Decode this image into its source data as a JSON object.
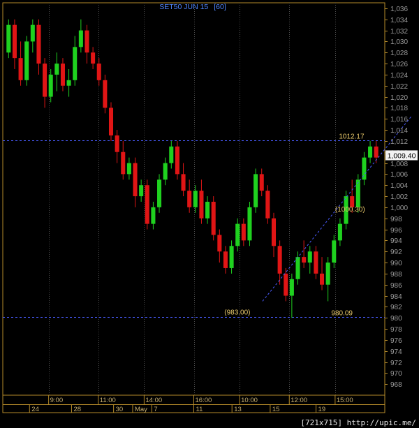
{
  "chart_data": {
    "type": "candlestick",
    "title": "SET50 JUN 15",
    "interval": "[60]",
    "ylim": [
      966,
      1037
    ],
    "y_ticks": [
      968,
      970,
      972,
      974,
      976,
      978,
      980,
      982,
      984,
      986,
      988,
      990,
      992,
      994,
      996,
      998,
      1000,
      1002,
      1004,
      1006,
      1008,
      1010,
      1012,
      1014,
      1016,
      1018,
      1020,
      1022,
      1024,
      1026,
      1028,
      1030,
      1032,
      1034,
      1036
    ],
    "y_tick_labels": [
      "968",
      "970",
      "972",
      "974",
      "976",
      "978",
      "980",
      "982",
      "984",
      "986",
      "988",
      "990",
      "992",
      "994",
      "996",
      "998",
      "1,000",
      "1,002",
      "1,004",
      "1,006",
      "1,008",
      "1,010",
      "1,012",
      "1,014",
      "1,016",
      "1,018",
      "1,020",
      "1,022",
      "1,024",
      "1,026",
      "1,028",
      "1,030",
      "1,032",
      "1,034",
      "1,036"
    ],
    "current_price": 1009.4,
    "current_price_label": "1,009.40",
    "levels": [
      {
        "value": 1012.17,
        "label": "1012.17",
        "label_x": 88
      },
      {
        "value": 980.09,
        "label": "980.09",
        "label_x": 86
      }
    ],
    "annotations": [
      {
        "label": "(983.00)",
        "x": 58,
        "y": 981.0
      },
      {
        "label": "(1000.30)",
        "x": 87,
        "y": 999.6
      }
    ],
    "trendline": {
      "x1": 68,
      "y1": 983.0,
      "x2": 107,
      "y2": 1016.5
    },
    "time_labels": [
      {
        "label": "9:00",
        "x": 12
      },
      {
        "label": "11:00",
        "x": 25
      },
      {
        "label": "14:00",
        "x": 37
      },
      {
        "label": "16:00",
        "x": 50
      },
      {
        "label": "10:00",
        "x": 62
      },
      {
        "label": "12:00",
        "x": 75
      },
      {
        "label": "15:00",
        "x": 87
      }
    ],
    "date_labels": [
      {
        "label": "24",
        "x": 7
      },
      {
        "label": "28",
        "x": 18
      },
      {
        "label": "30",
        "x": 29
      },
      {
        "label": "May",
        "x": 34
      },
      {
        "label": "7",
        "x": 39
      },
      {
        "label": "11",
        "x": 50
      },
      {
        "label": "13",
        "x": 60
      },
      {
        "label": "15",
        "x": 70
      },
      {
        "label": "19",
        "x": 82
      }
    ],
    "candles": [
      {
        "x": 0,
        "o": 1028,
        "h": 1034,
        "l": 1027,
        "c": 1033
      },
      {
        "x": 1,
        "o": 1033,
        "h": 1034,
        "l": 1025,
        "c": 1027
      },
      {
        "x": 2,
        "o": 1027,
        "h": 1030,
        "l": 1022,
        "c": 1023
      },
      {
        "x": 3,
        "o": 1023,
        "h": 1031,
        "l": 1022,
        "c": 1030
      },
      {
        "x": 4,
        "o": 1030,
        "h": 1034,
        "l": 1028,
        "c": 1033
      },
      {
        "x": 5,
        "o": 1033,
        "h": 1034,
        "l": 1024,
        "c": 1026
      },
      {
        "x": 6,
        "o": 1026,
        "h": 1027,
        "l": 1018,
        "c": 1020
      },
      {
        "x": 7,
        "o": 1020,
        "h": 1025,
        "l": 1019,
        "c": 1024
      },
      {
        "x": 8,
        "o": 1024,
        "h": 1028,
        "l": 1021,
        "c": 1026
      },
      {
        "x": 9,
        "o": 1026,
        "h": 1027,
        "l": 1021,
        "c": 1022
      },
      {
        "x": 10,
        "o": 1022,
        "h": 1025,
        "l": 1020,
        "c": 1023
      },
      {
        "x": 11,
        "o": 1023,
        "h": 1031,
        "l": 1022,
        "c": 1029
      },
      {
        "x": 12,
        "o": 1029,
        "h": 1034,
        "l": 1028,
        "c": 1032
      },
      {
        "x": 13,
        "o": 1032,
        "h": 1033,
        "l": 1026,
        "c": 1028
      },
      {
        "x": 14,
        "o": 1028,
        "h": 1029,
        "l": 1025,
        "c": 1026
      },
      {
        "x": 15,
        "o": 1026,
        "h": 1027,
        "l": 1022,
        "c": 1023
      },
      {
        "x": 16,
        "o": 1023,
        "h": 1024,
        "l": 1017,
        "c": 1018
      },
      {
        "x": 17,
        "o": 1018,
        "h": 1019,
        "l": 1012,
        "c": 1013
      },
      {
        "x": 18,
        "o": 1013,
        "h": 1014,
        "l": 1008,
        "c": 1010
      },
      {
        "x": 19,
        "o": 1010,
        "h": 1012,
        "l": 1005,
        "c": 1006
      },
      {
        "x": 20,
        "o": 1006,
        "h": 1009,
        "l": 1005,
        "c": 1008
      },
      {
        "x": 21,
        "o": 1008,
        "h": 1009,
        "l": 1000,
        "c": 1002
      },
      {
        "x": 22,
        "o": 1002,
        "h": 1005,
        "l": 1001,
        "c": 1004
      },
      {
        "x": 23,
        "o": 1004,
        "h": 1005,
        "l": 996,
        "c": 997
      },
      {
        "x": 24,
        "o": 997,
        "h": 1001,
        "l": 996,
        "c": 1000
      },
      {
        "x": 25,
        "o": 1000,
        "h": 1006,
        "l": 999,
        "c": 1005
      },
      {
        "x": 26,
        "o": 1005,
        "h": 1009,
        "l": 1004,
        "c": 1008
      },
      {
        "x": 27,
        "o": 1008,
        "h": 1012,
        "l": 1007,
        "c": 1011
      },
      {
        "x": 28,
        "o": 1011,
        "h": 1012,
        "l": 1005,
        "c": 1006
      },
      {
        "x": 29,
        "o": 1006,
        "h": 1008,
        "l": 1002,
        "c": 1003
      },
      {
        "x": 30,
        "o": 1003,
        "h": 1005,
        "l": 999,
        "c": 1000
      },
      {
        "x": 31,
        "o": 1000,
        "h": 1004,
        "l": 999,
        "c": 1003
      },
      {
        "x": 32,
        "o": 1003,
        "h": 1005,
        "l": 997,
        "c": 998
      },
      {
        "x": 33,
        "o": 998,
        "h": 1002,
        "l": 997,
        "c": 1001
      },
      {
        "x": 34,
        "o": 1001,
        "h": 1002,
        "l": 994,
        "c": 995
      },
      {
        "x": 35,
        "o": 995,
        "h": 996,
        "l": 990,
        "c": 992
      },
      {
        "x": 36,
        "o": 992,
        "h": 993,
        "l": 988,
        "c": 989
      },
      {
        "x": 37,
        "o": 989,
        "h": 994,
        "l": 988,
        "c": 993
      },
      {
        "x": 38,
        "o": 993,
        "h": 998,
        "l": 992,
        "c": 997
      },
      {
        "x": 39,
        "o": 997,
        "h": 998,
        "l": 993,
        "c": 994
      },
      {
        "x": 40,
        "o": 994,
        "h": 1001,
        "l": 993,
        "c": 1000
      },
      {
        "x": 41,
        "o": 1000,
        "h": 1007,
        "l": 999,
        "c": 1006
      },
      {
        "x": 42,
        "o": 1006,
        "h": 1007,
        "l": 1002,
        "c": 1003
      },
      {
        "x": 43,
        "o": 1003,
        "h": 1004,
        "l": 997,
        "c": 998
      },
      {
        "x": 44,
        "o": 998,
        "h": 999,
        "l": 991,
        "c": 993
      },
      {
        "x": 45,
        "o": 993,
        "h": 994,
        "l": 986,
        "c": 988
      },
      {
        "x": 46,
        "o": 988,
        "h": 989,
        "l": 983,
        "c": 984
      },
      {
        "x": 47,
        "o": 984,
        "h": 988,
        "l": 980,
        "c": 987
      },
      {
        "x": 48,
        "o": 987,
        "h": 992,
        "l": 986,
        "c": 991
      },
      {
        "x": 49,
        "o": 991,
        "h": 994,
        "l": 989,
        "c": 990
      },
      {
        "x": 50,
        "o": 990,
        "h": 993,
        "l": 988,
        "c": 992
      },
      {
        "x": 51,
        "o": 992,
        "h": 993,
        "l": 987,
        "c": 988
      },
      {
        "x": 52,
        "o": 988,
        "h": 991,
        "l": 985,
        "c": 986
      },
      {
        "x": 53,
        "o": 986,
        "h": 991,
        "l": 983,
        "c": 990
      },
      {
        "x": 54,
        "o": 990,
        "h": 995,
        "l": 989,
        "c": 994
      },
      {
        "x": 55,
        "o": 994,
        "h": 998,
        "l": 993,
        "c": 997
      },
      {
        "x": 56,
        "o": 997,
        "h": 1003,
        "l": 996,
        "c": 1002
      },
      {
        "x": 57,
        "o": 1002,
        "h": 1005,
        "l": 999,
        "c": 1000
      },
      {
        "x": 58,
        "o": 1000,
        "h": 1006,
        "l": 999,
        "c": 1005
      },
      {
        "x": 59,
        "o": 1005,
        "h": 1010,
        "l": 1004,
        "c": 1009
      },
      {
        "x": 60,
        "o": 1009,
        "h": 1012,
        "l": 1008,
        "c": 1011
      },
      {
        "x": 61,
        "o": 1011,
        "h": 1012,
        "l": 1008,
        "c": 1009
      }
    ]
  }
}
